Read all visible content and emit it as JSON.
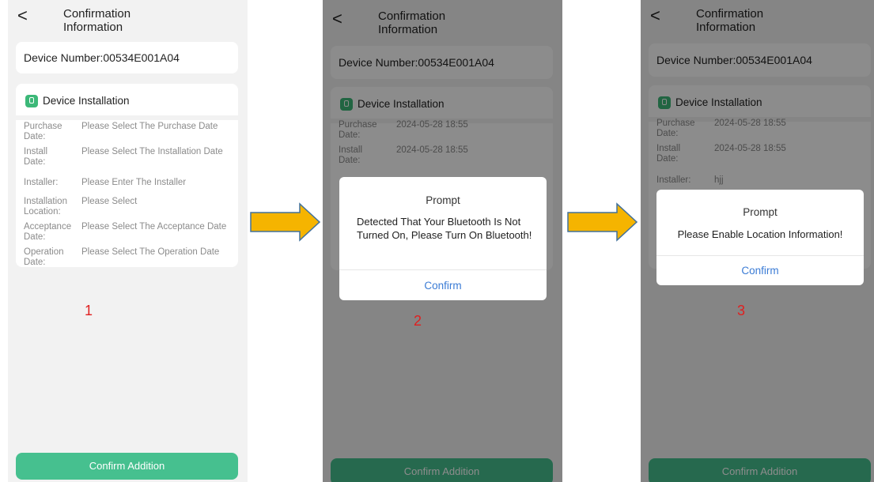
{
  "header": {
    "back_glyph": "<",
    "title": "Confirmation Information"
  },
  "device": {
    "number": "Device Number:00534E001A04"
  },
  "installation": {
    "heading": "Device Installation",
    "icon": "device-icon",
    "accent": "#3cb878"
  },
  "screen1": {
    "rows": [
      {
        "label": "Purchase Date:",
        "value": "Please Select The Purchase Date"
      },
      {
        "label": "Install Date:",
        "value": "Please Select The Installation Date"
      },
      {
        "label": "Installer:",
        "value": "Please Enter The Installer"
      },
      {
        "label": "Installation Location:",
        "value": "Please Select"
      },
      {
        "label": "Acceptance Date:",
        "value": "Please Select The Acceptance Date"
      },
      {
        "label": "Operation Date:",
        "value": "Please Select The Operation Date"
      }
    ],
    "step": "1"
  },
  "screen2": {
    "rows": [
      {
        "label": "Purchase Date:",
        "value": "2024-05-28 18:55"
      },
      {
        "label": "Install Date:",
        "value": "2024-05-28 18:55"
      }
    ],
    "dialog": {
      "title": "Prompt",
      "message": "Detected That Your Bluetooth Is Not Turned On, Please Turn On Bluetooth!",
      "button": "Confirm"
    },
    "step": "2"
  },
  "screen3": {
    "rows": [
      {
        "label": "Purchase Date:",
        "value": "2024-05-28 18:55"
      },
      {
        "label": "Install Date:",
        "value": "2024-05-28 18:55"
      },
      {
        "label": "Installer:",
        "value": "hjj"
      }
    ],
    "dialog": {
      "title": "Prompt",
      "message": "Please Enable Location Information!",
      "button": "Confirm"
    },
    "step": "3"
  },
  "bottom_button": {
    "label": "Confirm Addition",
    "color": "#46c08f"
  },
  "colors": {
    "step_number": "#e02020",
    "dialog_button": "#3a7bd5",
    "arrow_fill": "#f5b400",
    "arrow_stroke": "#41719c"
  }
}
